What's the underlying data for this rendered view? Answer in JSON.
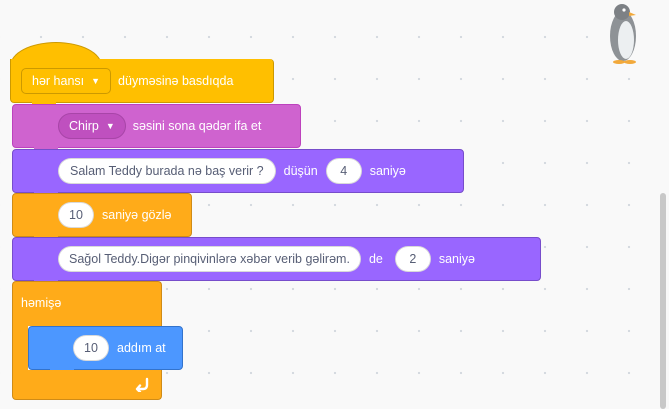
{
  "script": {
    "when_key_pressed": {
      "key": "hər hansı",
      "label": "düyməsinə basdıqda"
    },
    "play_sound": {
      "sound": "Chirp",
      "label": "səsini sona qədər ifa et"
    },
    "think_for_secs": {
      "message": "Salam Teddy  burada nə baş verir ?",
      "label": "düşün",
      "secs": "4",
      "unit": "saniyə"
    },
    "wait": {
      "secs": "10",
      "label": "saniyə gözlə"
    },
    "say_for_secs": {
      "message": "Sağol Teddy.Digər pinqivinlərə xəbər verib gəlirəm.",
      "label": "de",
      "secs": "2",
      "unit": "saniyə"
    },
    "forever": {
      "label": "həmişə"
    },
    "move_steps": {
      "steps": "10",
      "label": "addım at"
    }
  },
  "icons": {
    "dropdown": "caret-down-icon",
    "loop": "loop-arrow-icon",
    "sprite": "penguin-sprite-icon"
  },
  "colors": {
    "events": "#ffbf00",
    "sound": "#cf63cf",
    "looks": "#9966ff",
    "control": "#ffab19",
    "motion": "#4c97ff",
    "canvas": "#f9f9f9"
  }
}
